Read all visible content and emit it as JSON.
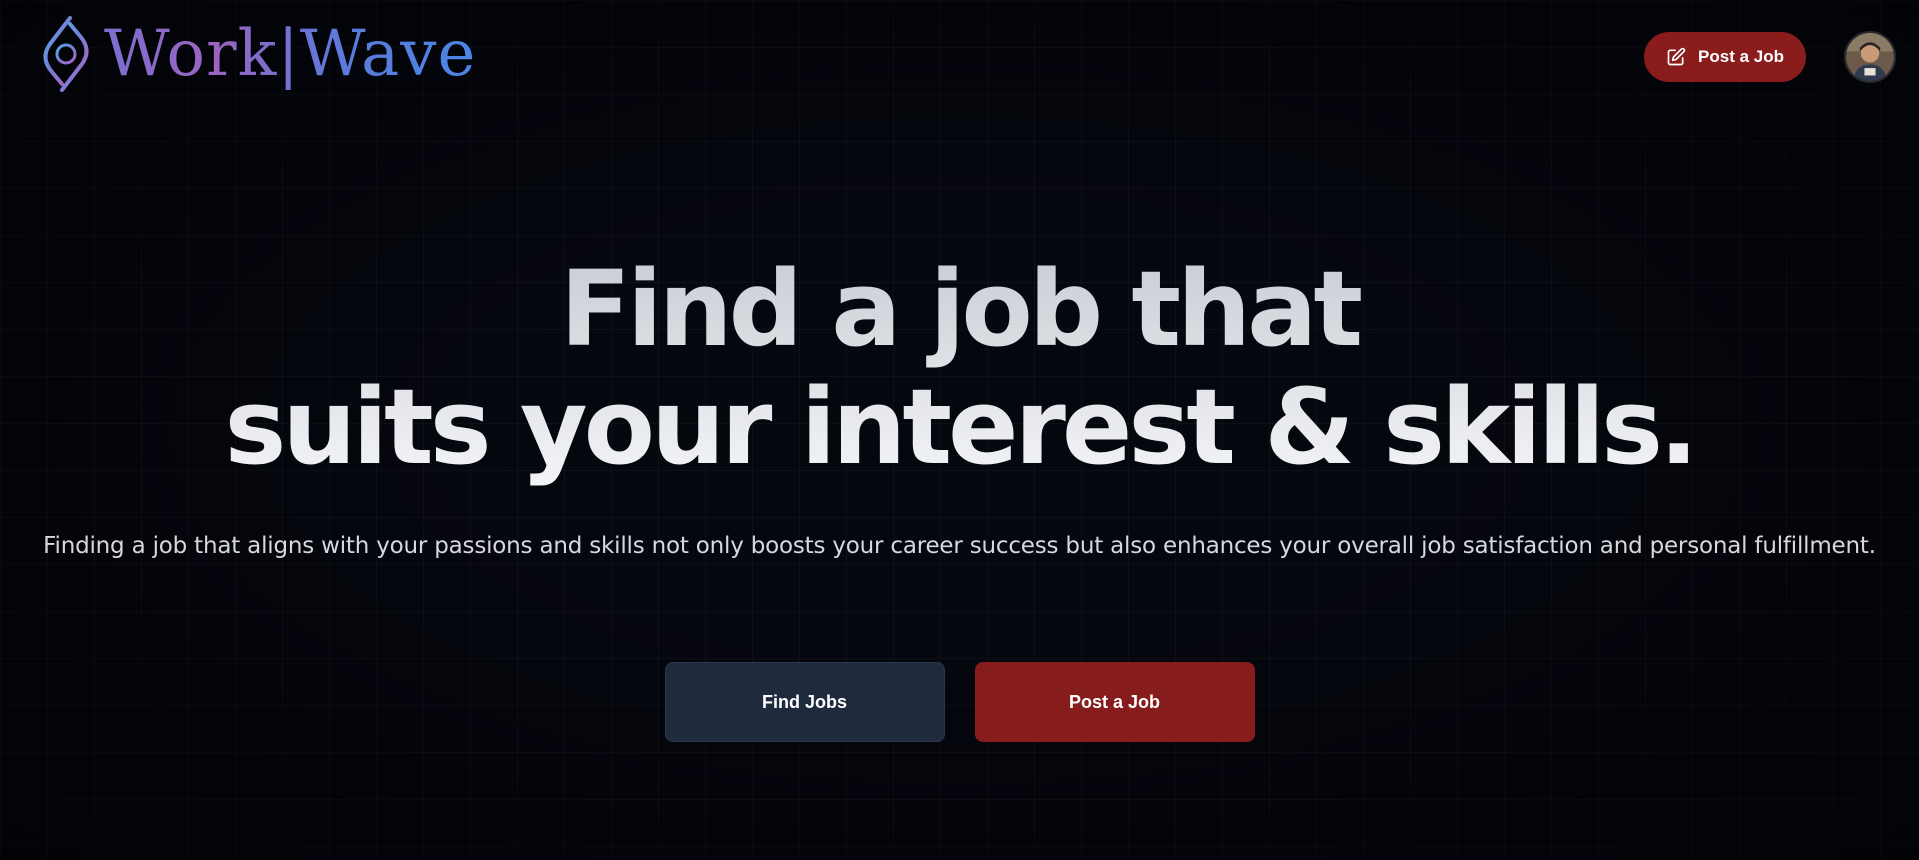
{
  "header": {
    "brand_name": "Work|Wave",
    "post_job_label": "Post a Job",
    "post_job_icon": "edit-square-icon",
    "avatar_icon": "user-avatar"
  },
  "hero": {
    "headline_line1": "Find a job that",
    "headline_line2": "suits your interest & skills.",
    "subtitle": "Finding a job that aligns with your passions and skills not only boosts your career success but also enhances your overall job satisfaction and personal fulfillment.",
    "find_jobs_label": "Find Jobs",
    "post_job_label": "Post a Job"
  },
  "colors": {
    "background": "#05070f",
    "accent_red": "#861c1c",
    "button_dark": "#1f2a3d",
    "brand_gradient_start": "#7b6fd0",
    "brand_gradient_end": "#4a86e6"
  }
}
